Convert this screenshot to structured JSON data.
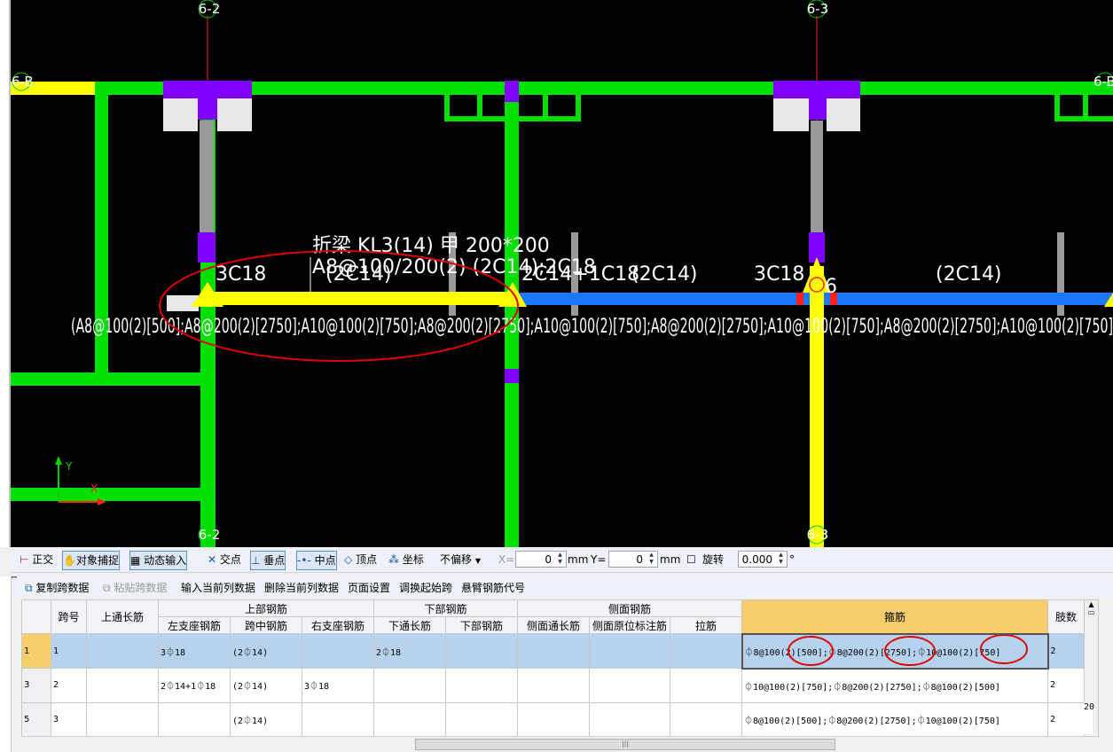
{
  "cad": {
    "axes": {
      "a62_top": "6-2",
      "a63_top": "6-3",
      "a62_bot": "6-2",
      "a63_bot": "6-3",
      "a6b_left": "6-B",
      "a6b_right": "6-B"
    },
    "beam_title": "折梁 KL3(14) 甲 200*200",
    "beam_stirrup": "A8@100/200(2) (2C14);2C18",
    "labels": {
      "l1": "3C18",
      "l2": "(2C14)",
      "l3": "2C14+1C18",
      "l4": "(2C14)",
      "l5": "3C18",
      "l6": "6",
      "l7": "(2C14)",
      "stirrup_line": "(A8@100(2)[500];A8@200(2)[2750];A10@100(2)[750];A8@200(2)[2750];A10@100(2)[750];A8@200(2)[2750];A10@100(2)[750];A8@200(2)[2750];A10@100(2)[750]"
    },
    "ucs": {
      "x": "X",
      "y": "Y"
    },
    "colors": {
      "bg": "#000000",
      "green": "#00e000",
      "yellow": "#ffff00",
      "blue": "#1e78ff",
      "purple": "#8000ff",
      "red": "#ff0000"
    }
  },
  "snapbar": {
    "ortho": "正交",
    "osnap": "对象捕捉",
    "dyn": "动态输入",
    "intersect": "交点",
    "perp": "垂点",
    "mid": "中点",
    "vertex": "顶点",
    "coord": "坐标",
    "offset": "不偏移",
    "x_label": "X=",
    "x_val": "0",
    "mm1": "mm",
    "y_label": "Y=",
    "y_val": "0",
    "mm2": "mm",
    "rotate": "旋转",
    "rot_val": "0.000",
    "deg": "°"
  },
  "gridbar": {
    "copy": "复制跨数据",
    "paste": "粘贴跨数据",
    "input_col": "输入当前列数据",
    "del_col": "删除当前列数据",
    "page": "页面设置",
    "swap": "调换起始跨",
    "cant": "悬臂钢筋代号"
  },
  "table": {
    "h_span": "跨号",
    "h_top_cont": "上通长筋",
    "h_top": "上部钢筋",
    "h_bot": "下部钢筋",
    "h_side": "侧面钢筋",
    "h_stirrup": "箍筋",
    "h_legs": "肢数",
    "h_left": "左支座钢筋",
    "h_mid": "跨中钢筋",
    "h_right": "右支座钢筋",
    "h_bot_cont": "下通长筋",
    "h_bot_rebar": "下部钢筋",
    "h_side_cont": "侧面通长筋",
    "h_side_orig": "侧面原位标注筋",
    "h_tie": "拉筋",
    "rows": [
      {
        "rn": "1",
        "span": "1",
        "top_cont": "",
        "left": "3⏀18",
        "mid": "(2⏀14)",
        "right": "",
        "bot_cont": "2⏀18",
        "bot": "",
        "side_cont": "",
        "side_orig": "",
        "tie": "",
        "stirrup": "⏀8@100(2)[500];⏀8@200(2)[2750];⏀10@100(2)[750]",
        "legs": "2",
        "extra": ""
      },
      {
        "rn": "3",
        "span": "2",
        "top_cont": "",
        "left": "2⏀14+1⏀18",
        "mid": "(2⏀14)",
        "right": "3⏀18",
        "bot_cont": "",
        "bot": "",
        "side_cont": "",
        "side_orig": "",
        "tie": "",
        "stirrup": "⏀10@100(2)[750];⏀8@200(2)[2750];⏀8@100(2)[500]",
        "legs": "2",
        "extra": ""
      },
      {
        "rn": "5",
        "span": "3",
        "top_cont": "",
        "left": "",
        "mid": "(2⏀14)",
        "right": "",
        "bot_cont": "",
        "bot": "",
        "side_cont": "",
        "side_orig": "",
        "tie": "",
        "stirrup": "⏀8@100(2)[500];⏀8@200(2)[2750];⏀10@100(2)[750]",
        "legs": "2",
        "extra": "20"
      }
    ]
  }
}
